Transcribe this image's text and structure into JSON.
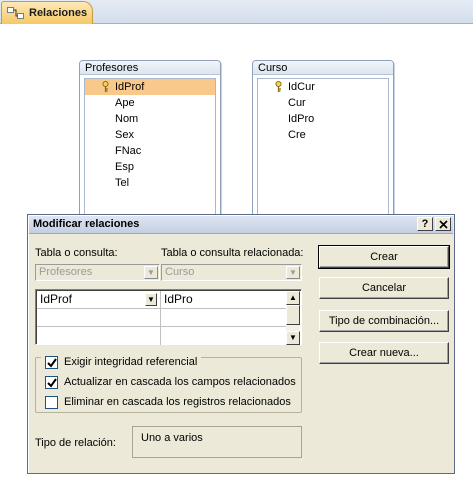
{
  "tab": {
    "label": "Relaciones",
    "icon": "relationships-icon"
  },
  "tables": [
    {
      "name": "Profesores",
      "fields": [
        "IdProf",
        "Ape",
        "Nom",
        "Sex",
        "FNac",
        "Esp",
        "Tel"
      ],
      "key_field": "IdProf",
      "selected_field": "IdProf"
    },
    {
      "name": "Curso",
      "fields": [
        "IdCur",
        "Cur",
        "IdPro",
        "Cre"
      ],
      "key_field": "IdCur"
    }
  ],
  "dialog": {
    "title": "Modificar relaciones",
    "help_label": "?",
    "close_label": "X",
    "table_label": "Tabla o consulta:",
    "related_label": "Tabla o consulta relacionada:",
    "table_value": "Profesores",
    "related_value": "Curso",
    "join": {
      "left": "IdProf",
      "right": "IdPro"
    },
    "buttons": {
      "create": "Crear",
      "cancel": "Cancelar",
      "join_type": "Tipo de combinación...",
      "new": "Crear nueva..."
    },
    "options": [
      {
        "label": "Exigir integridad referencial",
        "checked": true
      },
      {
        "label": "Actualizar en cascada los campos relacionados",
        "checked": true
      },
      {
        "label": "Eliminar en cascada los registros relacionados",
        "checked": false
      }
    ],
    "relation_type_label": "Tipo de relación:",
    "relation_type_value": "Uno a varios"
  }
}
